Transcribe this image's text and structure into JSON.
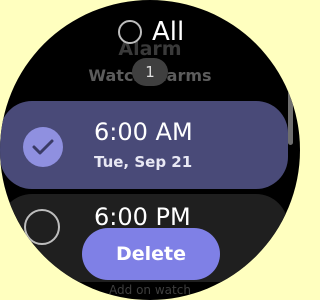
{
  "header": {
    "select_all_label": "All",
    "title": "Alarm",
    "selected_count": "1",
    "subtitle": "Watch alarms"
  },
  "alarms": [
    {
      "time": "6:00 AM",
      "date": "Tue, Sep 21",
      "selected": true
    },
    {
      "time": "6:00 PM",
      "date": "",
      "selected": false
    }
  ],
  "actions": {
    "delete_label": "Delete"
  },
  "footer": {
    "text": "Add on watch"
  },
  "colors": {
    "background": "#FFFFBF",
    "selected_card": "#494A78",
    "accent": "#7F80E6",
    "unselected_card": "#1F1F1F"
  },
  "icons": {
    "select_all": "circle-outline-icon",
    "selected": "check-icon",
    "unselected": "circle-outline-icon"
  }
}
